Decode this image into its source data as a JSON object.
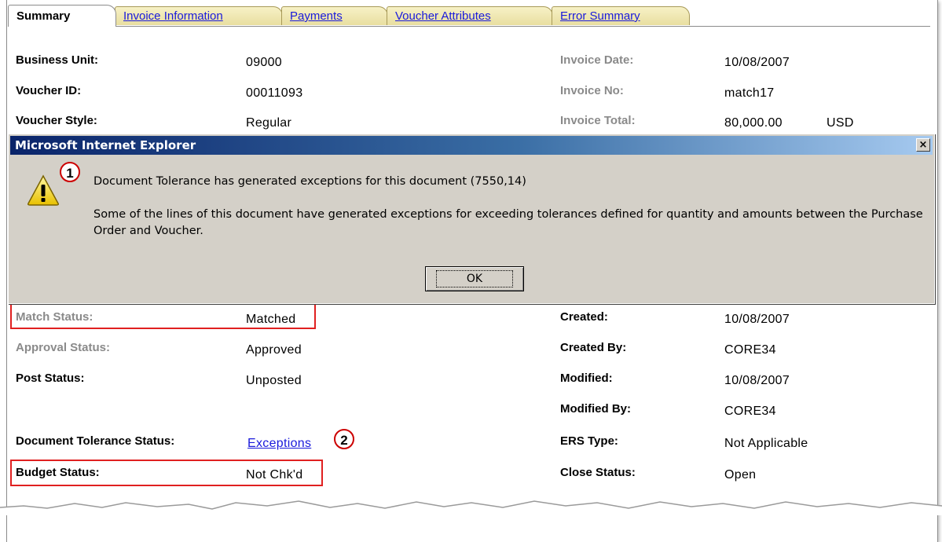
{
  "tabs": [
    {
      "label": "Summary",
      "active": true
    },
    {
      "label": "Invoice Information",
      "active": false
    },
    {
      "label": "Payments",
      "active": false
    },
    {
      "label": "Voucher Attributes",
      "active": false
    },
    {
      "label": "Error Summary",
      "active": false
    }
  ],
  "header": {
    "business_unit": {
      "label": "Business Unit:",
      "value": "09000"
    },
    "voucher_id": {
      "label": "Voucher ID:",
      "value": "00011093"
    },
    "voucher_style": {
      "label": "Voucher Style:",
      "value": "Regular"
    },
    "invoice_date": {
      "label": "Invoice Date:",
      "value": "10/08/2007"
    },
    "invoice_no": {
      "label": "Invoice No:",
      "value": "match17"
    },
    "invoice_total": {
      "label": "Invoice Total:",
      "value": "80,000.00",
      "currency": "USD"
    }
  },
  "dialog": {
    "title": "Microsoft Internet Explorer",
    "close_glyph": "×",
    "icon": "warning-icon",
    "message_line1": "Document  Tolerance has generated exceptions for this document (7550,14)",
    "message_line2": "Some of the lines of this document have generated exceptions for exceeding tolerances defined for quantity and amounts between the Purchase Order and Voucher.",
    "ok_label": "OK"
  },
  "status": {
    "match_status": {
      "label": "Match Status:",
      "value": "Matched"
    },
    "approval_status": {
      "label": "Approval Status:",
      "value": "Approved"
    },
    "post_status": {
      "label": "Post Status:",
      "value": "Unposted"
    },
    "doc_tolerance_status": {
      "label": "Document Tolerance Status:",
      "value": "Exceptions"
    },
    "budget_status": {
      "label": "Budget Status:",
      "value": "Not Chk'd"
    },
    "created": {
      "label": "Created:",
      "value": "10/08/2007"
    },
    "created_by": {
      "label": "Created By:",
      "value": "CORE34"
    },
    "modified": {
      "label": "Modified:",
      "value": "10/08/2007"
    },
    "modified_by": {
      "label": "Modified By:",
      "value": "CORE34"
    },
    "ers_type": {
      "label": "ERS Type:",
      "value": "Not Applicable"
    },
    "close_status": {
      "label": "Close Status:",
      "value": "Open"
    }
  },
  "callouts": [
    "1",
    "2"
  ],
  "colors": {
    "link": "#1a1adb",
    "highlight": "#e02020",
    "dialog_bg": "#d4d0c8",
    "titlebar": "#0a246a"
  }
}
